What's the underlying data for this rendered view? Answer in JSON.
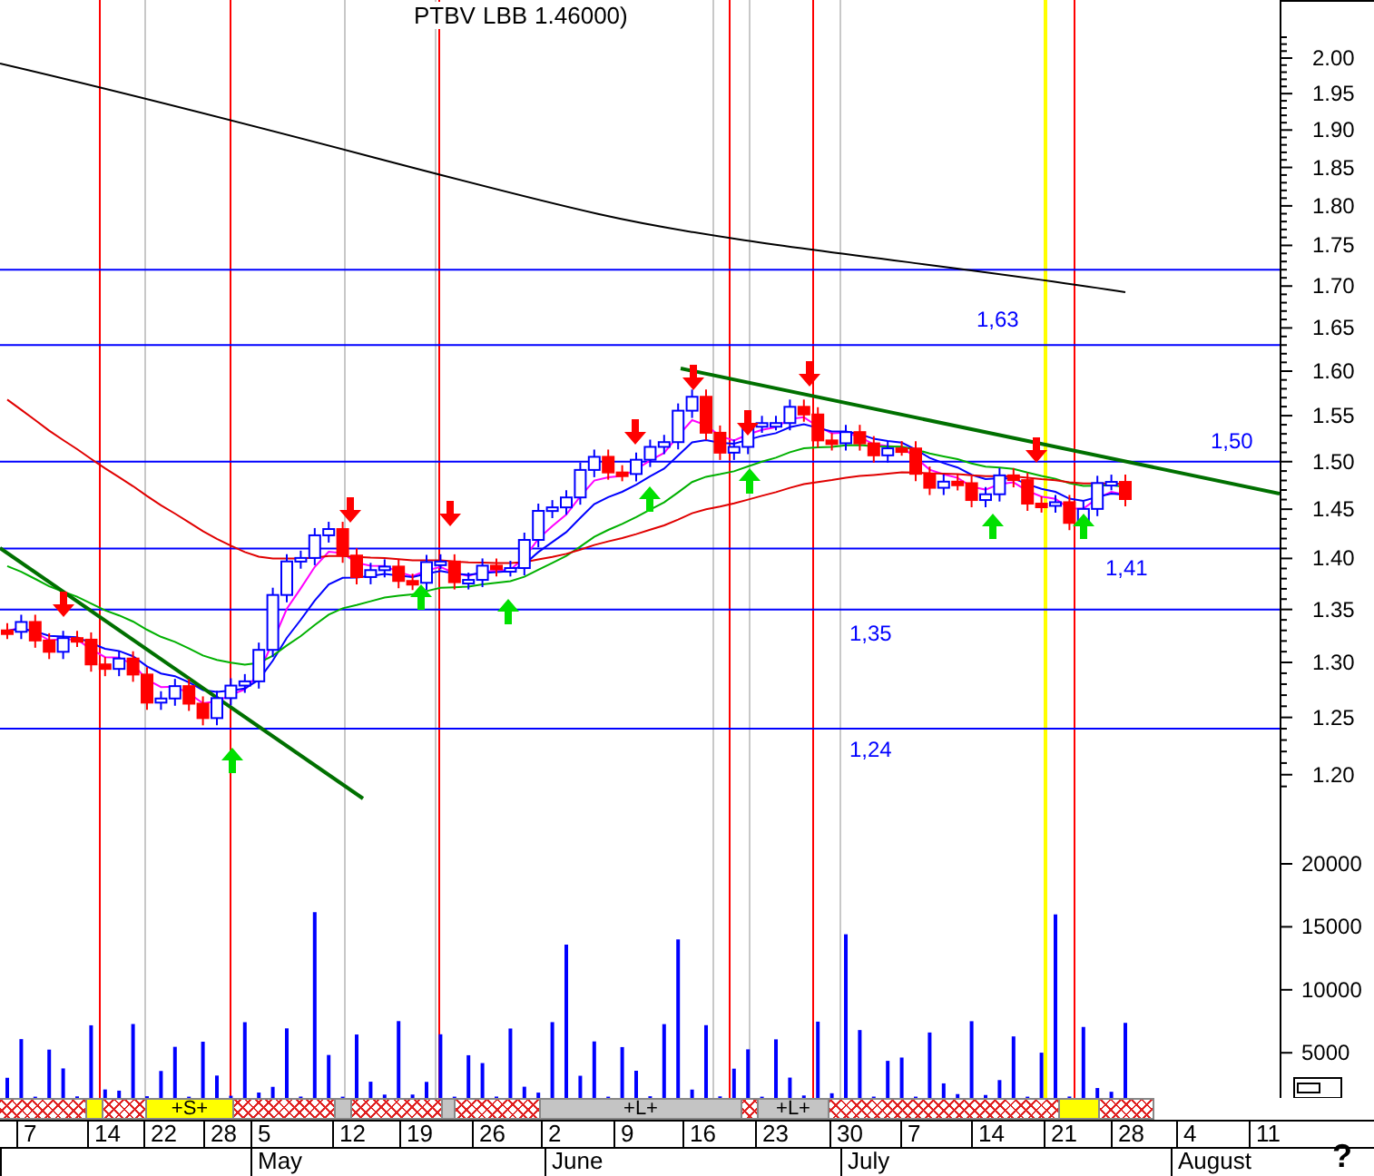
{
  "title": {
    "parts": [
      "PTBV",
      "LBB",
      "1.46000)"
    ]
  },
  "levels": [
    {
      "label": "1,63"
    },
    {
      "label": "1,50"
    },
    {
      "label": "1,41"
    },
    {
      "label": "1,35"
    },
    {
      "label": "1,24"
    }
  ],
  "price_axis": {
    "ticks": [
      "2.00",
      "1.95",
      "1.90",
      "1.85",
      "1.80",
      "1.75",
      "1.70",
      "1.65",
      "1.60",
      "1.55",
      "1.50",
      "1.45",
      "1.40",
      "1.35",
      "1.30",
      "1.25",
      "1.20"
    ]
  },
  "volume_axis": {
    "ticks": [
      "20000",
      "15000",
      "10000",
      "5000"
    ]
  },
  "signal_band": [
    {
      "kind": "hatched"
    },
    {
      "kind": "highlight"
    },
    {
      "kind": "hatched"
    },
    {
      "kind": "highlight",
      "label": "+S+"
    },
    {
      "kind": "hatched"
    },
    {
      "kind": "neutral"
    },
    {
      "kind": "hatched"
    },
    {
      "kind": "neutral"
    },
    {
      "kind": "hatched"
    },
    {
      "kind": "neutral",
      "label": "+L+"
    },
    {
      "kind": "hatched"
    },
    {
      "kind": "neutral",
      "label": "+L+"
    },
    {
      "kind": "hatched"
    },
    {
      "kind": "highlight"
    },
    {
      "kind": "hatched"
    }
  ],
  "dates": [
    "7",
    "14",
    "22",
    "28",
    "5",
    "12",
    "19",
    "26",
    "2",
    "9",
    "16",
    "23",
    "30",
    "7",
    "14",
    "21",
    "28",
    "4",
    "11"
  ],
  "months": [
    "May",
    "June",
    "July",
    "August"
  ],
  "help": "?"
}
